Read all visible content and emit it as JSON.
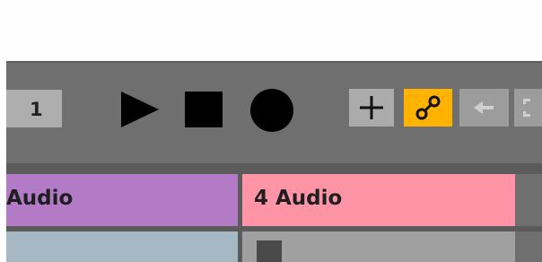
{
  "transport": {
    "bar_value": "1",
    "buttons": {
      "play": "play-icon",
      "stop": "stop-icon",
      "record": "record-icon",
      "add": "plus-icon",
      "link": "link-icon",
      "back": "arrow-left-icon"
    },
    "accent_color": "#ffb200"
  },
  "tracks": [
    {
      "label": "Audio",
      "color": "#b37ac5"
    },
    {
      "label": "4 Audio",
      "color": "#ff94a6"
    }
  ]
}
